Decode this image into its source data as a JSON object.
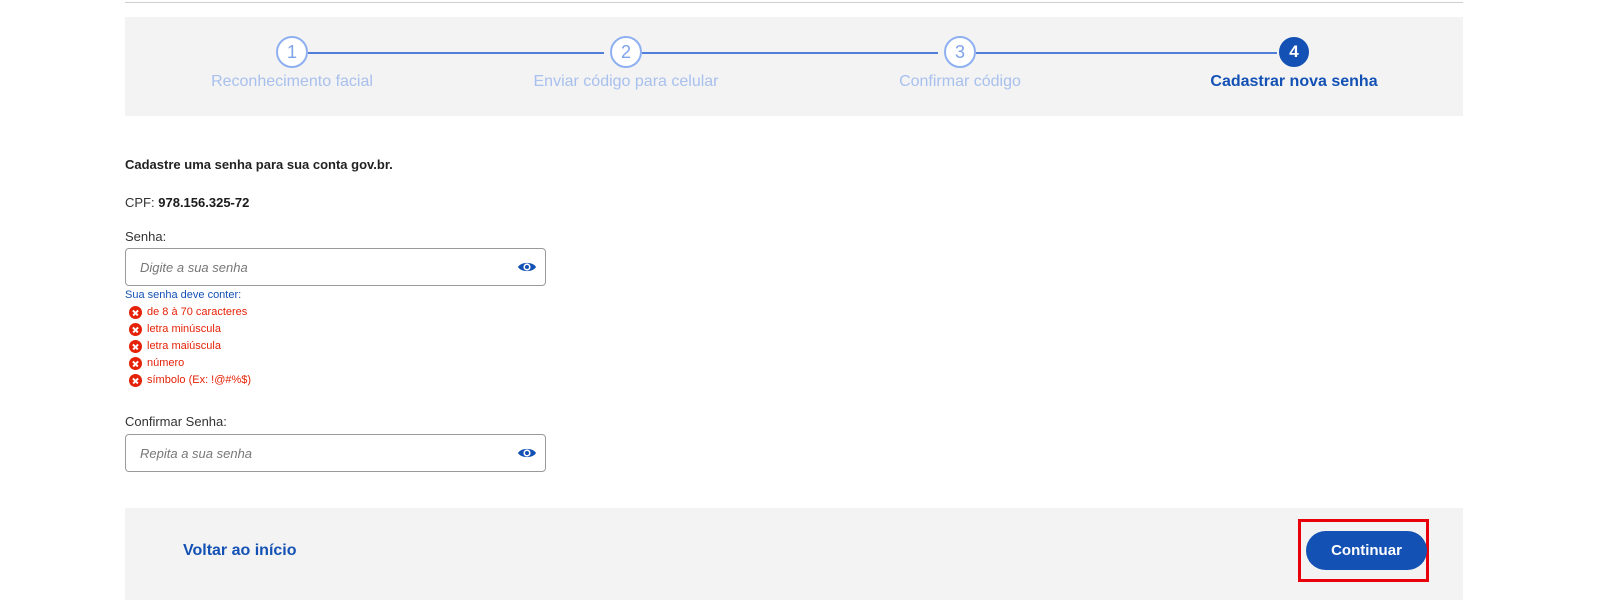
{
  "stepper": {
    "steps": [
      {
        "number": "1",
        "label": "Reconhecimento facial"
      },
      {
        "number": "2",
        "label": "Enviar código para celular"
      },
      {
        "number": "3",
        "label": "Confirmar código"
      },
      {
        "number": "4",
        "label": "Cadastrar nova senha"
      }
    ],
    "active_step": 4
  },
  "form": {
    "intro": "Cadastre uma senha para sua conta gov.br.",
    "cpf_label": "CPF:",
    "cpf_value": "978.156.325-72",
    "password": {
      "label": "Senha:",
      "placeholder": "Digite a sua senha",
      "value": ""
    },
    "rules_title": "Sua senha deve conter:",
    "rules": [
      "de 8 à 70 caracteres",
      "letra minúscula",
      "letra maiúscula",
      "número",
      "símbolo (Ex: !@#%$)"
    ],
    "confirm": {
      "label": "Confirmar Senha:",
      "placeholder": "Repita a sua senha",
      "value": ""
    }
  },
  "footer": {
    "back_label": "Voltar ao início",
    "continue_label": "Continuar"
  },
  "colors": {
    "primary": "#1351b4",
    "error": "#e52207",
    "highlight": "#e8000b",
    "panel_bg": "#f3f3f3"
  },
  "icons": {
    "reveal": "eye-icon",
    "rule_status": "x-circle-icon"
  }
}
